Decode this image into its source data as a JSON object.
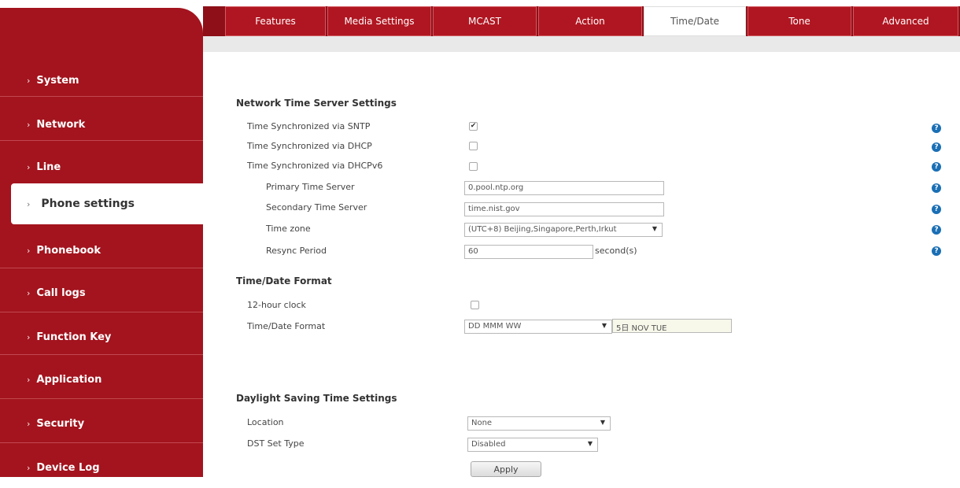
{
  "sidebar": {
    "items": [
      {
        "label": "System"
      },
      {
        "label": "Network"
      },
      {
        "label": "Line"
      },
      {
        "label": "Phone settings"
      },
      {
        "label": "Phonebook"
      },
      {
        "label": "Call logs"
      },
      {
        "label": "Function Key"
      },
      {
        "label": "Application"
      },
      {
        "label": "Security"
      },
      {
        "label": "Device Log"
      }
    ],
    "active": "Phone settings"
  },
  "tabs": [
    {
      "label": "Features"
    },
    {
      "label": "Media Settings"
    },
    {
      "label": "MCAST"
    },
    {
      "label": "Action"
    },
    {
      "label": "Time/Date"
    },
    {
      "label": "Tone"
    },
    {
      "label": "Advanced"
    }
  ],
  "active_tab": "Time/Date",
  "network_time": {
    "title": "Network Time Server Settings",
    "sntp_label": "Time Synchronized via SNTP",
    "sntp_checked": true,
    "dhcp_label": "Time Synchronized via DHCP",
    "dhcp_checked": false,
    "dhcpv6_label": "Time Synchronized via DHCPv6",
    "dhcpv6_checked": false,
    "primary_label": "Primary Time Server",
    "primary_value": "0.pool.ntp.org",
    "secondary_label": "Secondary Time Server",
    "secondary_value": "time.nist.gov",
    "timezone_label": "Time zone",
    "timezone_value": "(UTC+8) Beijing,Singapore,Perth,Irkut",
    "resync_label": "Resync Period",
    "resync_value": "60",
    "resync_unit": "second(s)"
  },
  "time_format": {
    "title": "Time/Date Format",
    "clock12_label": "12-hour clock",
    "clock12_checked": false,
    "format_label": "Time/Date Format",
    "format_value": "DD MMM WW",
    "format_preview": "5日 NOV TUE"
  },
  "dst": {
    "title": "Daylight Saving Time Settings",
    "location_label": "Location",
    "location_value": "None",
    "type_label": "DST Set Type",
    "type_value": "Disabled"
  },
  "apply_label": "Apply",
  "help_glyph": "?",
  "check_glyph": "✔",
  "chevron_glyph": "›",
  "dropdown_glyph": "▼",
  "colors": {
    "sidebar_red": "#a3141e",
    "tab_red": "#b01621",
    "help_blue": "#1a6fb5"
  }
}
